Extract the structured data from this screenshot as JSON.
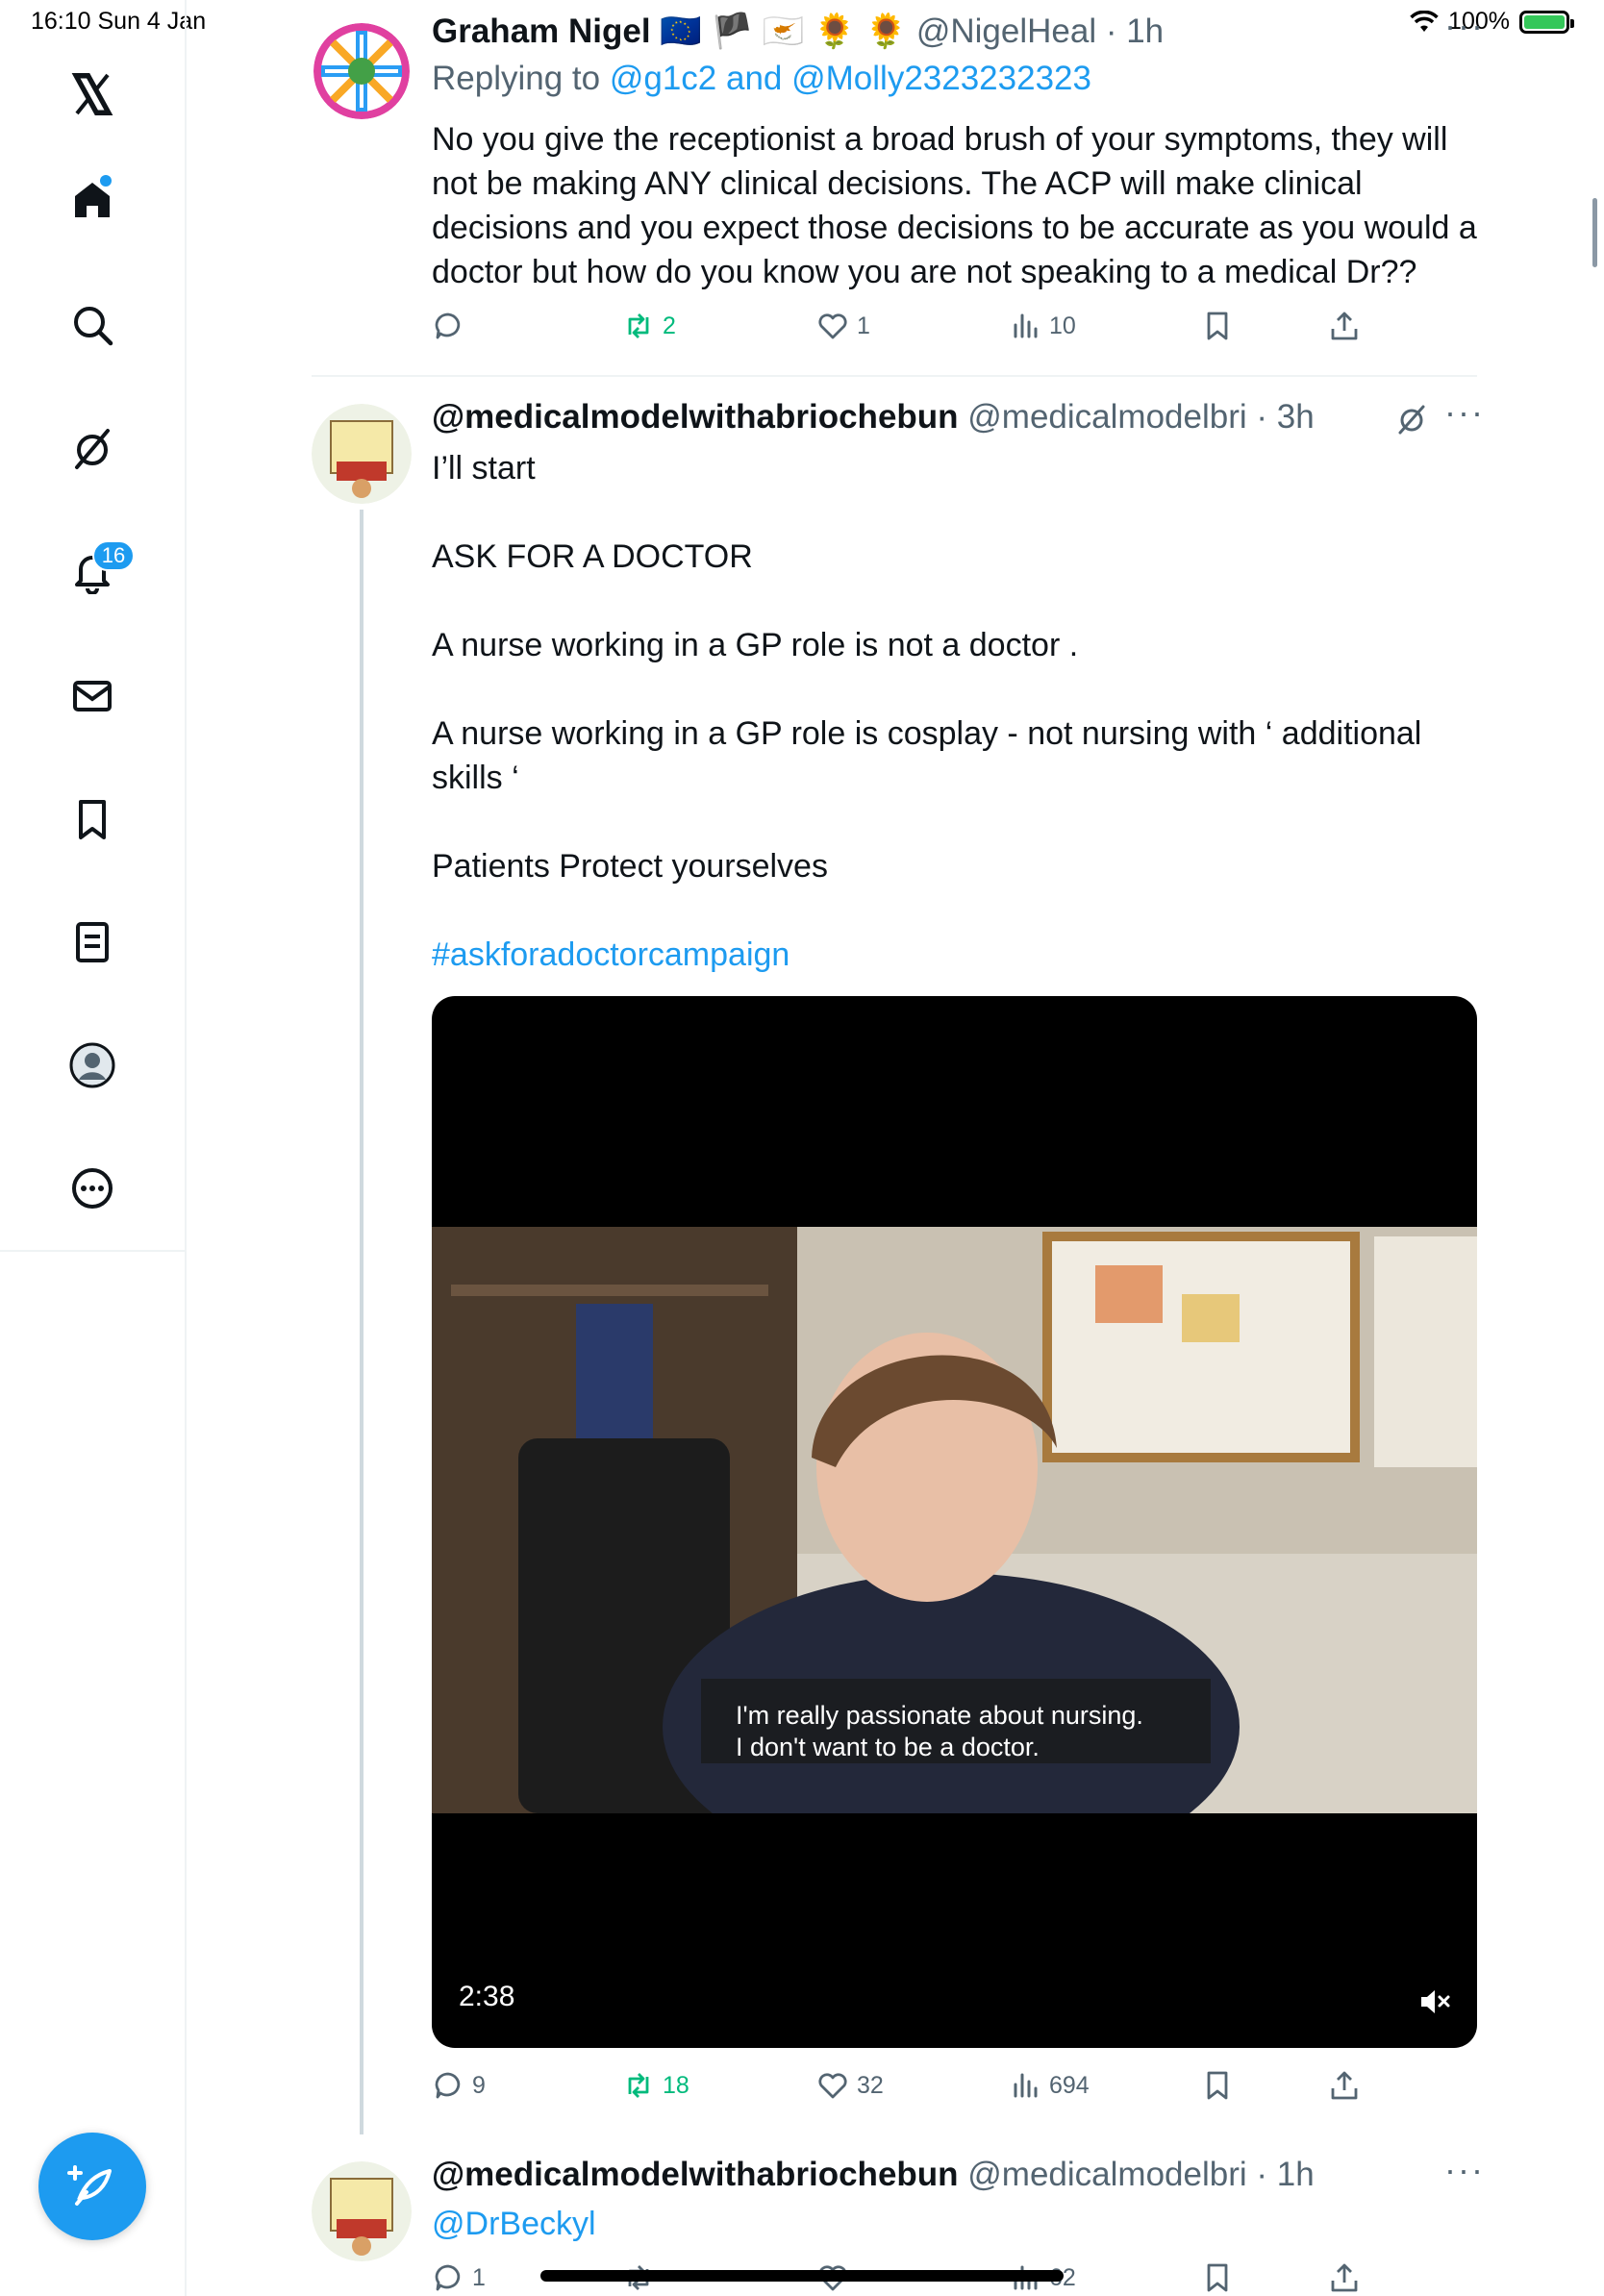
{
  "status_bar": {
    "time_date": "16:10  Sun 4 Jan",
    "battery": "100%",
    "battery_level": 1.0
  },
  "sidebar": {
    "notifications_badge": "16"
  },
  "tweets": [
    {
      "name": "Graham Nigel",
      "flags": "🇪🇺 🏴 🇨🇾 🌻 🌻",
      "handle_time": "@NigelHeal · 1h",
      "replying_prefix": "Replying to",
      "replying_to": "@g1c2 and @Molly2323232323",
      "text": "No you give the receptionist a broad brush of your symptoms, they will not be making ANY clinical decisions. The ACP  will make clinical decisions and you expect those decisions to be accurate as you would a doctor but how do you know you are not speaking to a medical Dr??",
      "replies": "",
      "retweets": "2",
      "likes": "1",
      "views": "10"
    },
    {
      "name": "@medicalmodelwithabriochebun",
      "handle_time": "@medicalmodelbri · 3h",
      "avatar_text": "General Medical Council NO CONFIDENCE",
      "lines": [
        "I’ll start",
        "ASK FOR A DOCTOR",
        "A nurse working in a GP role is not a doctor .",
        "A nurse working in a GP role is cosplay - not nursing with ‘ additional skills ‘",
        "Patients Protect yourselves"
      ],
      "hashtag": "#askforadoctorcampaign",
      "video": {
        "subtitle_1": "I'm really passionate about nursing.",
        "subtitle_2": "I don't want to be a doctor.",
        "duration": "2:38"
      },
      "replies": "9",
      "retweets": "18",
      "likes": "32",
      "views": "694"
    },
    {
      "name": "@medicalmodelwithabriochebun",
      "handle_time": "@medicalmodelbri · 1h",
      "text": "@DrBeckyl",
      "replies": "1",
      "views": "62"
    }
  ],
  "colors": {
    "accent": "#1d9bf0",
    "retweet_green": "#00ba7c",
    "muted_text": "#536471"
  }
}
